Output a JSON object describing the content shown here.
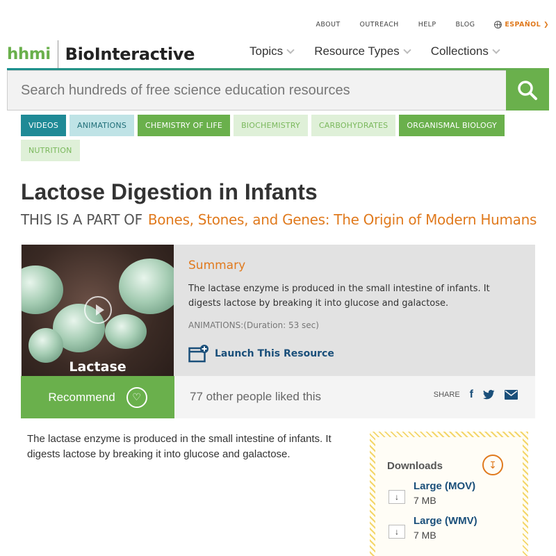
{
  "util_nav": {
    "about": "ABOUT",
    "outreach": "OUTREACH",
    "help": "HELP",
    "blog": "BLOG",
    "language": "ESPAÑOL"
  },
  "logo": {
    "hhmi": "hhmi",
    "product": "BioInteractive"
  },
  "main_nav": {
    "items": [
      {
        "label": "Topics"
      },
      {
        "label": "Resource Types"
      },
      {
        "label": "Collections"
      }
    ]
  },
  "search": {
    "placeholder": "Search hundreds of free science education resources",
    "icon": "search-icon"
  },
  "tags": [
    {
      "label": "VIDEOS",
      "style": "dark-teal"
    },
    {
      "label": "ANIMATIONS",
      "style": "light-teal"
    },
    {
      "label": "CHEMISTRY OF LIFE",
      "style": "green"
    },
    {
      "label": "BIOCHEMISTRY",
      "style": "light-green"
    },
    {
      "label": "CARBOHYDRATES",
      "style": "light-green"
    },
    {
      "label": "ORGANISMAL BIOLOGY",
      "style": "green"
    },
    {
      "label": "NUTRITION",
      "style": "light-green"
    }
  ],
  "page": {
    "title": "Lactose Digestion in Infants",
    "part_of_label": "This is a part of",
    "part_of_link": "Bones, Stones, and Genes: The Origin of Modern Humans"
  },
  "feature": {
    "thumbnail_label": "Lactase",
    "summary_heading": "Summary",
    "summary_text": "The lactase enzyme is produced in the small intestine of infants. It digests lactose by breaking it into glucose and galactose.",
    "duration": "ANIMATIONS:(Duration: 53 sec)",
    "launch_label": "Launch This Resource"
  },
  "engagement": {
    "recommend_label": "Recommend",
    "liked_text": "77 other people liked this",
    "share_label": "SHARE"
  },
  "body_text": "The lactase enzyme is produced in the small intestine of infants. It digests lactose by breaking it into glucose and galactose.",
  "downloads": {
    "heading": "Downloads",
    "items": [
      {
        "name": "Large (MOV)",
        "size": "7 MB"
      },
      {
        "name": "Large (WMV)",
        "size": "7 MB"
      }
    ]
  },
  "colors": {
    "teal": "#1a8f8f",
    "green": "#6ab04c",
    "orange": "#e07a1e",
    "link_blue": "#1a4f7a"
  }
}
